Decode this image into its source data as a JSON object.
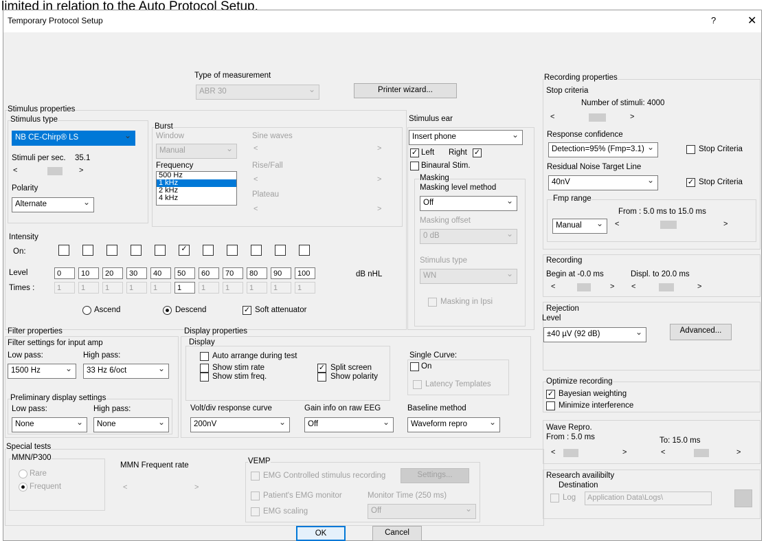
{
  "page_header": "limited in relation to the Auto Protocol Setup.",
  "window": {
    "title": "Temporary Protocol Setup",
    "help": "?",
    "close": "✕"
  },
  "type_meas": {
    "label": "Type of measurement",
    "value": "ABR 30"
  },
  "printer_wizard": "Printer wizard...",
  "stim": {
    "group": "Stimulus properties",
    "type_label": "Stimulus type",
    "type_value": "NB CE-Chirp® LS",
    "per_sec_label": "Stimuli per sec.",
    "per_sec_value": "35.1",
    "polarity_label": "Polarity",
    "polarity_value": "Alternate"
  },
  "burst": {
    "group": "Burst",
    "window_label": "Window",
    "window_value": "Manual",
    "frequency_label": "Frequency",
    "frequencies": [
      "500 Hz",
      "1 kHz",
      "2 kHz",
      "4 kHz"
    ],
    "sine_label": "Sine waves",
    "rise_label": "Rise/Fall",
    "plateau_label": "Plateau"
  },
  "ear": {
    "group": "Stimulus ear",
    "value": "Insert phone",
    "left": "Left",
    "right": "Right",
    "binaural": "Binaural Stim.",
    "masking_label": "Masking",
    "masking_method_label": "Masking level method",
    "masking_method_value": "Off",
    "masking_offset_label": "Masking offset",
    "masking_offset_value": "0 dB",
    "stimulus_type_label": "Stimulus type",
    "stimulus_type_value": "WN",
    "masking_ipsi": "Masking in Ipsi"
  },
  "intensity": {
    "group": "Intensity",
    "on_label": "On:",
    "level_label": "Level",
    "times_label": "Times :",
    "levels": [
      "0",
      "10",
      "20",
      "30",
      "40",
      "50",
      "60",
      "70",
      "80",
      "90",
      "100"
    ],
    "times": [
      "1",
      "1",
      "1",
      "1",
      "1",
      "1",
      "1",
      "1",
      "1",
      "1",
      "1"
    ],
    "unit": "dB nHL",
    "ascend": "Ascend",
    "descend": "Descend",
    "soft": "Soft attenuator"
  },
  "filter": {
    "group": "Filter properties",
    "input_group": "Filter settings for input amp",
    "low_label": "Low pass:",
    "high_label": "High pass:",
    "low_value": "1500 Hz",
    "high_value": "33 Hz 6/oct",
    "prelim_group": "Preliminary display settings",
    "pre_low_label": "Low pass:",
    "pre_high_label": "High pass:",
    "pre_low_value": "None",
    "pre_high_value": "None"
  },
  "display": {
    "group": "Display properties",
    "sub": "Display",
    "auto_arrange": "Auto arrange during test",
    "show_rate": "Show stim rate",
    "show_freq": "Show stim freq.",
    "split": "Split screen",
    "polarity": "Show polarity",
    "single_label": "Single Curve:",
    "single_on": "On",
    "latency": "Latency Templates",
    "volt_label": "Volt/div response curve",
    "volt_value": "200nV",
    "gain_label": "Gain info on raw EEG",
    "gain_value": "Off",
    "baseline_label": "Baseline method",
    "baseline_value": "Waveform repro"
  },
  "special": {
    "group": "Special tests",
    "mmn_group": "MMN/P300",
    "rare": "Rare",
    "frequent": "Frequent",
    "mmn_rate": "MMN Frequent rate",
    "vemp_group": "VEMP",
    "emg_stim": "EMG Controlled stimulus recording",
    "settings": "Settings...",
    "emg_monitor": "Patient's EMG monitor",
    "monitor_time": "Monitor Time (250 ms)",
    "monitor_value": "Off",
    "emg_scaling": "EMG scaling"
  },
  "rec_props": {
    "group": "Recording properties",
    "stop_group": "Stop criteria",
    "num_stim": "Number of stimuli:  4000",
    "resp_conf_label": "Response confidence",
    "resp_conf_value": "Detection=95% (Fmp=3.1)",
    "stop_criteria": "Stop Criteria",
    "residual_label": "Residual Noise Target Line",
    "residual_value": "40nV",
    "fmp_group": "Fmp range",
    "fmp_value": "Manual",
    "fmp_range": "From : 5.0 ms to 15.0 ms"
  },
  "recording": {
    "group": "Recording",
    "begin": "Begin at  -0.0 ms",
    "displ": "Displ. to   20.0 ms"
  },
  "rejection": {
    "group": "Rejection",
    "level_label": "Level",
    "value": "±40 µV (92 dB)",
    "advanced": "Advanced..."
  },
  "optimize": {
    "group": "Optimize recording",
    "bayes": "Bayesian weighting",
    "minimize": "Minimize interference"
  },
  "wave": {
    "group": "Wave Repro.",
    "from": "From :  5.0 ms",
    "to": "To:   15.0 ms"
  },
  "research": {
    "group": "Research availibilty",
    "dest": "Destination",
    "log": "Log",
    "path": "Application Data\\Logs\\"
  },
  "ok": "OK",
  "cancel": "Cancel"
}
